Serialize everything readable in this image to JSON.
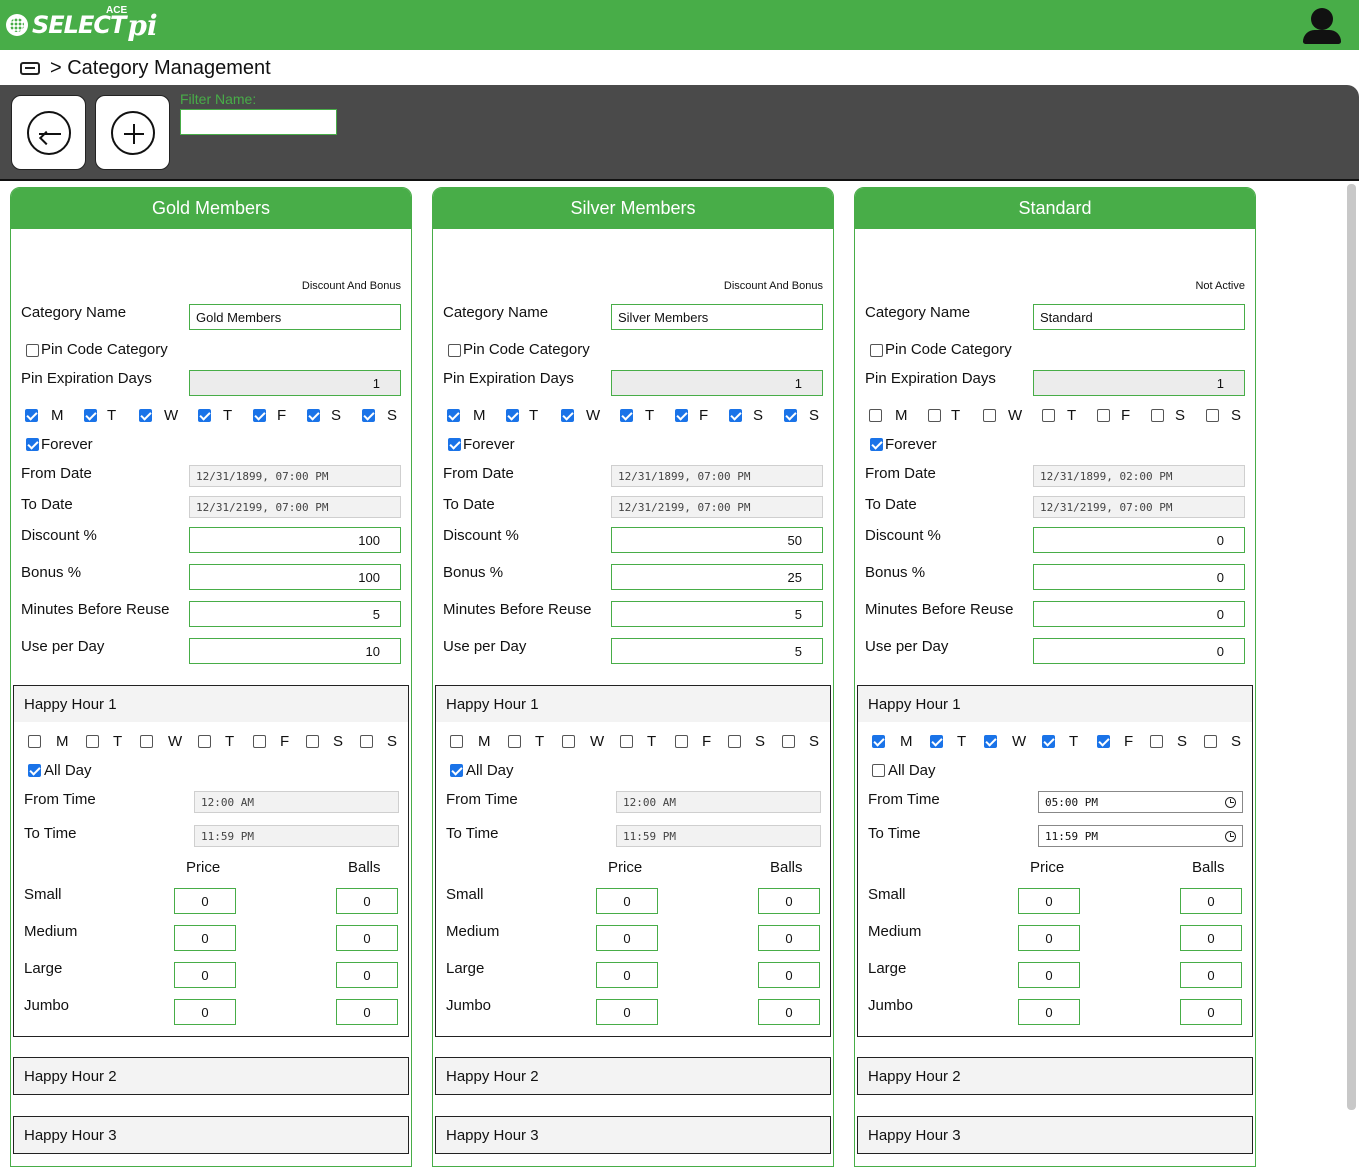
{
  "app": {
    "logo_text": "SELECT",
    "logo_pi": "pi",
    "logo_ace": "ACE"
  },
  "breadcrumb": {
    "text": "> Category Management"
  },
  "toolbar": {
    "filter_label": "Filter Name:",
    "filter_value": ""
  },
  "labels": {
    "category_name": "Category Name",
    "pin_code_category": "Pin Code Category",
    "pin_expiration_days": "Pin Expiration Days",
    "forever": "Forever",
    "from_date": "From Date",
    "to_date": "To Date",
    "discount": "Discount %",
    "bonus": "Bonus %",
    "minutes_before_reuse": "Minutes Before Reuse",
    "use_per_day": "Use per Day",
    "all_day": "All Day",
    "from_time": "From Time",
    "to_time": "To Time",
    "price": "Price",
    "balls": "Balls",
    "small": "Small",
    "medium": "Medium",
    "large": "Large",
    "jumbo": "Jumbo",
    "happy_hour_1": "Happy Hour 1",
    "happy_hour_2": "Happy Hour 2",
    "happy_hour_3": "Happy Hour 3"
  },
  "days": [
    "M",
    "T",
    "W",
    "T",
    "F",
    "S",
    "S"
  ],
  "categories": [
    {
      "title": "Gold Members",
      "status": "Discount And Bonus",
      "name": "Gold Members",
      "pin_code": false,
      "pin_expiration_days": "1",
      "days": [
        true,
        true,
        true,
        true,
        true,
        true,
        true
      ],
      "forever": true,
      "from_date": "12/31/1899, 07:00 PM",
      "to_date": "12/31/2199, 07:00 PM",
      "discount": "100",
      "bonus": "100",
      "minutes_before_reuse": "5",
      "use_per_day": "10",
      "hh1": {
        "days": [
          false,
          false,
          false,
          false,
          false,
          false,
          false
        ],
        "all_day": true,
        "from_time": "12:00 AM",
        "to_time": "11:59 PM",
        "time_enabled": false,
        "rows": [
          {
            "price": "0",
            "balls": "0"
          },
          {
            "price": "0",
            "balls": "0"
          },
          {
            "price": "0",
            "balls": "0"
          },
          {
            "price": "0",
            "balls": "0"
          }
        ]
      }
    },
    {
      "title": "Silver Members",
      "status": "Discount And Bonus",
      "name": "Silver Members",
      "pin_code": false,
      "pin_expiration_days": "1",
      "days": [
        true,
        true,
        true,
        true,
        true,
        true,
        true
      ],
      "forever": true,
      "from_date": "12/31/1899, 07:00 PM",
      "to_date": "12/31/2199, 07:00 PM",
      "discount": "50",
      "bonus": "25",
      "minutes_before_reuse": "5",
      "use_per_day": "5",
      "hh1": {
        "days": [
          false,
          false,
          false,
          false,
          false,
          false,
          false
        ],
        "all_day": true,
        "from_time": "12:00 AM",
        "to_time": "11:59 PM",
        "time_enabled": false,
        "rows": [
          {
            "price": "0",
            "balls": "0"
          },
          {
            "price": "0",
            "balls": "0"
          },
          {
            "price": "0",
            "balls": "0"
          },
          {
            "price": "0",
            "balls": "0"
          }
        ]
      }
    },
    {
      "title": "Standard",
      "status": "Not Active",
      "name": "Standard",
      "pin_code": false,
      "pin_expiration_days": "1",
      "days": [
        false,
        false,
        false,
        false,
        false,
        false,
        false
      ],
      "forever": true,
      "from_date": "12/31/1899, 02:00 PM",
      "to_date": "12/31/2199, 07:00 PM",
      "discount": "0",
      "bonus": "0",
      "minutes_before_reuse": "0",
      "use_per_day": "0",
      "hh1": {
        "days": [
          true,
          true,
          true,
          true,
          true,
          false,
          false
        ],
        "all_day": false,
        "from_time": "05:00 PM",
        "to_time": "11:59 PM",
        "time_enabled": true,
        "rows": [
          {
            "price": "0",
            "balls": "0"
          },
          {
            "price": "0",
            "balls": "0"
          },
          {
            "price": "0",
            "balls": "0"
          },
          {
            "price": "0",
            "balls": "0"
          }
        ]
      }
    }
  ]
}
